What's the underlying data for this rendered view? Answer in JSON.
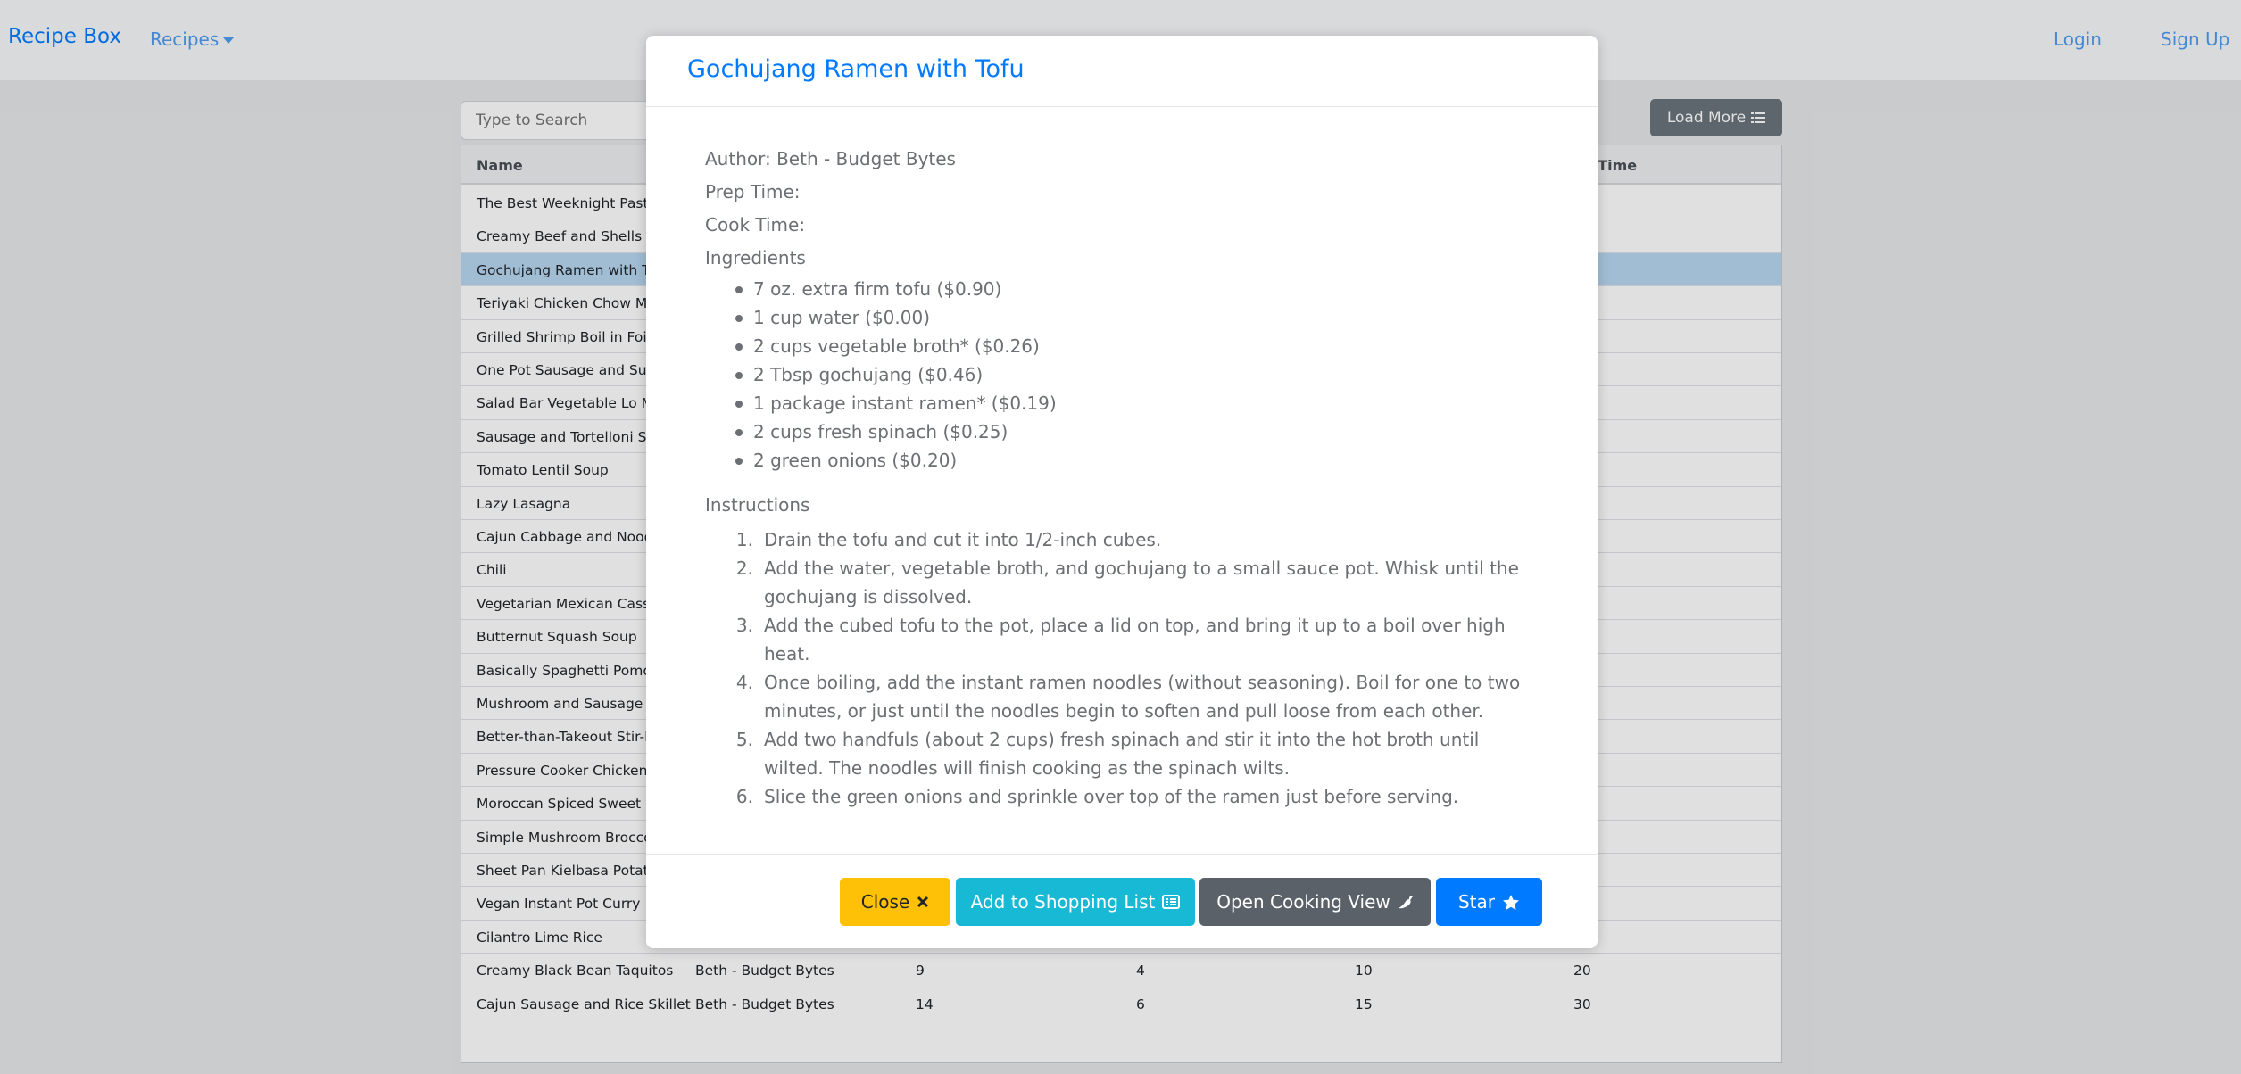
{
  "navbar": {
    "brand": "Recipe Box",
    "recipes_menu": "Recipes",
    "login": "Login",
    "signup": "Sign Up"
  },
  "toolbar": {
    "search_placeholder": "Type to Search",
    "load_more": "Load More"
  },
  "table": {
    "headers": [
      "Name",
      "",
      "",
      "",
      "",
      "ok Time"
    ],
    "rows": [
      {
        "name": "The Best Weeknight Pasta Sa",
        "author": "",
        "c1": "",
        "c2": "",
        "c3": "",
        "c4": ""
      },
      {
        "name": "Creamy Beef and Shells",
        "author": "",
        "c1": "",
        "c2": "",
        "c3": "",
        "c4": ""
      },
      {
        "name": "Gochujang Ramen with Tofu",
        "author": "",
        "c1": "",
        "c2": "",
        "c3": "",
        "c4": ""
      },
      {
        "name": "Teriyaki Chicken Chow Mein",
        "author": "",
        "c1": "",
        "c2": "",
        "c3": "",
        "c4": ""
      },
      {
        "name": "Grilled Shrimp Boil in Foil Pac",
        "author": "",
        "c1": "",
        "c2": "",
        "c3": "",
        "c4": ""
      },
      {
        "name": "One Pot Sausage and Sun D",
        "author": "",
        "c1": "",
        "c2": "",
        "c3": "",
        "c4": ""
      },
      {
        "name": "Salad Bar Vegetable Lo Mein",
        "author": "",
        "c1": "",
        "c2": "",
        "c3": "",
        "c4": ""
      },
      {
        "name": "Sausage and Tortelloni Soup",
        "author": "",
        "c1": "",
        "c2": "",
        "c3": "",
        "c4": ""
      },
      {
        "name": "Tomato Lentil Soup",
        "author": "",
        "c1": "",
        "c2": "",
        "c3": "",
        "c4": ""
      },
      {
        "name": "Lazy Lasagna",
        "author": "",
        "c1": "",
        "c2": "",
        "c3": "",
        "c4": ""
      },
      {
        "name": "Cajun Cabbage and Noodles",
        "author": "",
        "c1": "",
        "c2": "",
        "c3": "",
        "c4": ""
      },
      {
        "name": "Chili",
        "author": "",
        "c1": "",
        "c2": "",
        "c3": "",
        "c4": ""
      },
      {
        "name": "Vegetarian Mexican Casserol",
        "author": "",
        "c1": "",
        "c2": "",
        "c3": "",
        "c4": ""
      },
      {
        "name": "Butternut Squash Soup",
        "author": "",
        "c1": "",
        "c2": "",
        "c3": "",
        "c4": ""
      },
      {
        "name": "Basically Spaghetti Pomodoro",
        "author": "",
        "c1": "",
        "c2": "",
        "c3": "",
        "c4": ""
      },
      {
        "name": "Mushroom and Sausage Sou",
        "author": "",
        "c1": "",
        "c2": "",
        "c3": "",
        "c4": ""
      },
      {
        "name": "Better-than-Takeout Stir-Fried",
        "author": "",
        "c1": "",
        "c2": "",
        "c3": "",
        "c4": ""
      },
      {
        "name": "Pressure Cooker Chicken and",
        "author": "",
        "c1": "",
        "c2": "",
        "c3": "",
        "c4": ""
      },
      {
        "name": "Moroccan Spiced Sweet Pota",
        "author": "",
        "c1": "",
        "c2": "",
        "c3": "",
        "c4": ""
      },
      {
        "name": "Simple Mushroom Broccoli S",
        "author": "",
        "c1": "",
        "c2": "",
        "c3": "",
        "c4": ""
      },
      {
        "name": "Sheet Pan Kielbasa Potatoes",
        "author": "",
        "c1": "",
        "c2": "",
        "c3": "",
        "c4": ""
      },
      {
        "name": "Vegan Instant Pot Curry",
        "author": "",
        "c1": "",
        "c2": "",
        "c3": "",
        "c4": ""
      },
      {
        "name": "Cilantro Lime Rice",
        "author": "",
        "c1": "",
        "c2": "",
        "c3": "",
        "c4": ""
      },
      {
        "name": "Creamy Black Bean Taquitos",
        "author": "Beth - Budget Bytes",
        "c1": "9",
        "c2": "4",
        "c3": "10",
        "c4": "20"
      },
      {
        "name": "Cajun Sausage and Rice Skillet",
        "author": "Beth - Budget Bytes",
        "c1": "14",
        "c2": "6",
        "c3": "15",
        "c4": "30"
      }
    ],
    "selected_index": 2
  },
  "modal": {
    "title": "Gochujang Ramen with Tofu",
    "author": "Author: Beth - Budget Bytes",
    "prep_time": "Prep Time:",
    "cook_time": "Cook Time:",
    "ingredients_label": "Ingredients",
    "ingredients": [
      "7 oz. extra firm tofu ($0.90)",
      "1 cup water ($0.00)",
      "2 cups vegetable broth* ($0.26)",
      "2 Tbsp gochujang ($0.46)",
      "1 package instant ramen* ($0.19)",
      "2 cups fresh spinach ($0.25)",
      "2 green onions ($0.20)"
    ],
    "instructions_label": "Instructions",
    "instructions": [
      "Drain the tofu and cut it into 1/2-inch cubes.",
      "Add the water, vegetable broth, and gochujang to a small sauce pot. Whisk until the gochujang is dissolved.",
      "Add the cubed tofu to the pot, place a lid on top, and bring it up to a boil over high heat.",
      "Once boiling, add the instant ramen noodles (without seasoning). Boil for one to two minutes, or just until the noodles begin to soften and pull loose from each other.",
      "Add two handfuls (about 2 cups) fresh spinach and stir it into the hot broth until wilted. The noodles will finish cooking as the spinach wilts.",
      "Slice the green onions and sprinkle over top of the ramen just before serving."
    ],
    "buttons": {
      "close": "Close",
      "shopping": "Add to Shopping List",
      "cooking": "Open Cooking View",
      "star": "Star"
    }
  },
  "colors": {
    "primary": "#007bff",
    "warning": "#ffc107",
    "info": "#17b9d4",
    "secondary": "#5a6168"
  },
  "icons": {
    "close": "times-icon",
    "shopping": "list-alt-icon",
    "cooking": "pepper-icon",
    "star": "star-icon",
    "load_more": "list-icon",
    "recipes_menu": "caret-down-icon"
  }
}
